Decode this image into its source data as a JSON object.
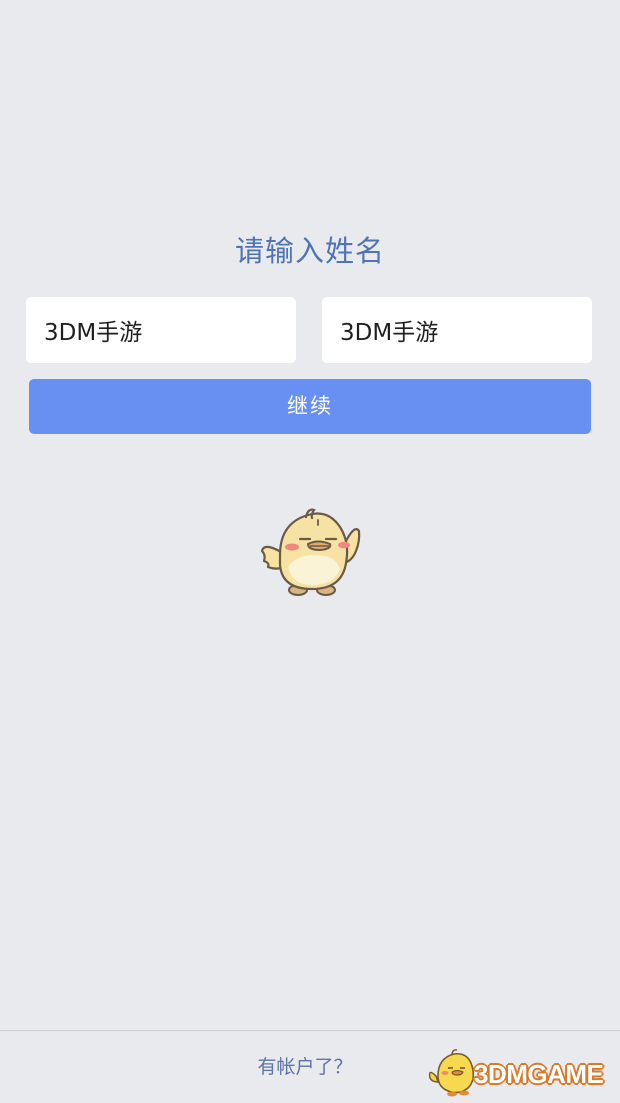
{
  "title": "请输入姓名",
  "form": {
    "first_name_value": "3DM手游",
    "last_name_value": "3DM手游"
  },
  "continue_label": "继续",
  "footer": {
    "have_account_label": "有帐户了？"
  },
  "watermark": {
    "text": "3DMGAME"
  },
  "colors": {
    "background": "#e9eaee",
    "title": "#4f73b5",
    "button": "#6890f2",
    "link": "#5d74a7"
  },
  "icons": {
    "mascot": "yellow-chick-mascot-icon",
    "watermark_logo": "3dmgame-chick-logo-icon"
  }
}
